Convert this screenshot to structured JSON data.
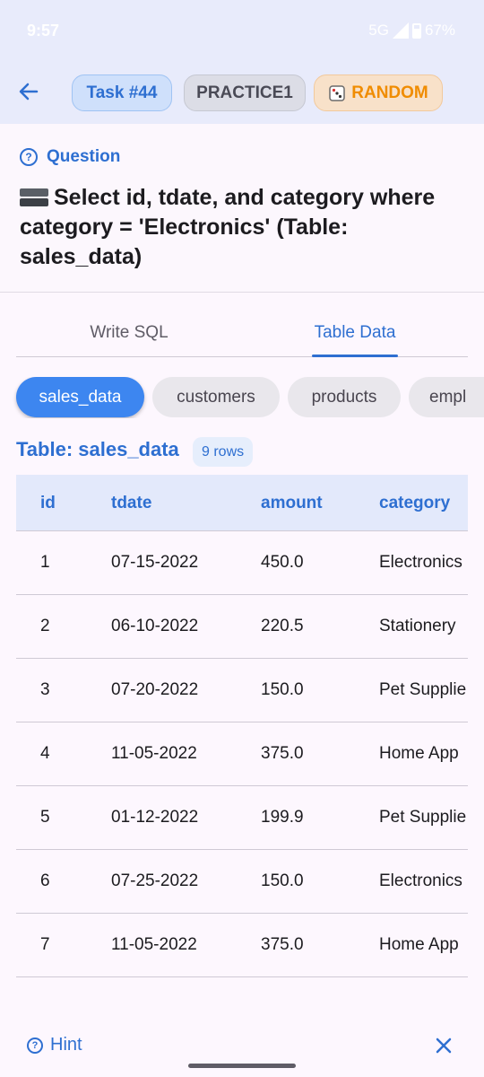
{
  "status_bar": {
    "time": "9:57",
    "network": "5G",
    "battery": "67%"
  },
  "header": {
    "task_chip": "Task #44",
    "practice_chip": "PRACTICE1",
    "random_chip": "RANDOM",
    "random_icon": "dice-icon"
  },
  "question": {
    "label": "Question",
    "text": "Select id, tdate, and category where category = 'Electronics' (Table: sales_data)"
  },
  "tabs": [
    {
      "label": "Write SQL",
      "active": false
    },
    {
      "label": "Table Data",
      "active": true
    }
  ],
  "table_chips": [
    {
      "label": "sales_data",
      "selected": true
    },
    {
      "label": "customers",
      "selected": false
    },
    {
      "label": "products",
      "selected": false
    },
    {
      "label": "empl",
      "selected": false
    }
  ],
  "table": {
    "title": "Table: sales_data",
    "rows_badge": "9 rows",
    "columns": [
      "id",
      "tdate",
      "amount",
      "category"
    ],
    "rows": [
      [
        "1",
        "07-15-2022",
        "450.0",
        "Electronics"
      ],
      [
        "2",
        "06-10-2022",
        "220.5",
        "Stationery"
      ],
      [
        "3",
        "07-20-2022",
        "150.0",
        "Pet Supplie"
      ],
      [
        "4",
        "11-05-2022",
        "375.0",
        "Home App"
      ],
      [
        "5",
        "01-12-2022",
        "199.9",
        "Pet Supplie"
      ],
      [
        "6",
        "07-25-2022",
        "150.0",
        "Electronics"
      ],
      [
        "7",
        "11-05-2022",
        "375.0",
        "Home App"
      ]
    ]
  },
  "footer": {
    "hint_label": "Hint"
  },
  "colors": {
    "accent": "#2e6fd1",
    "selected_chip": "#3d86f0",
    "random": "#f08c00"
  }
}
